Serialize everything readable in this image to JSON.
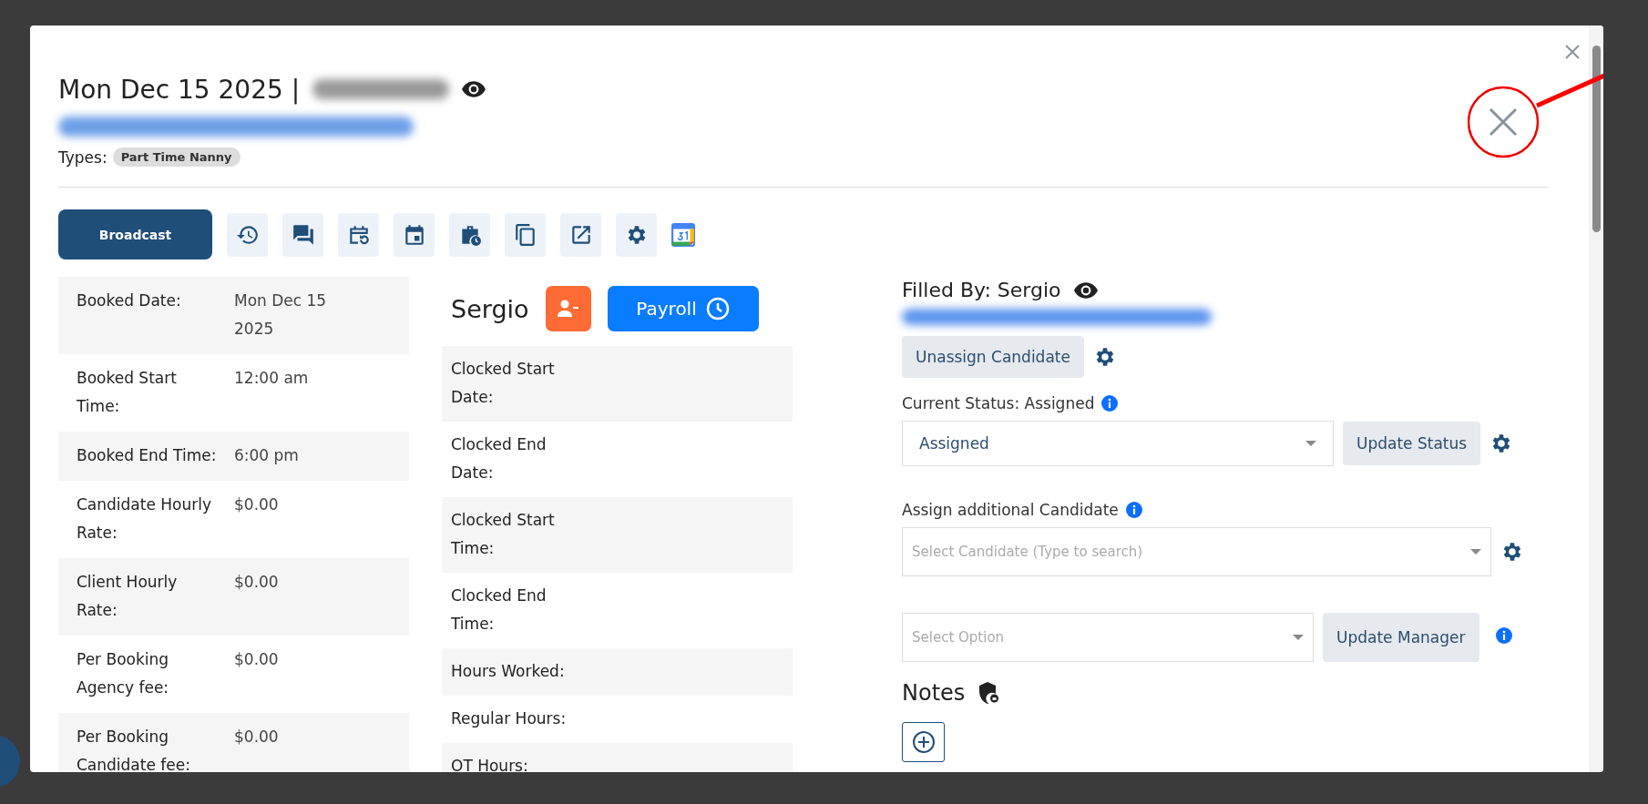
{
  "header": {
    "title": "Mon Dec 15 2025 |",
    "types_label": "Types:",
    "type_tags": [
      "Part Time Nanny"
    ]
  },
  "toolbar": {
    "primary": "Broadcast",
    "tools": [
      {
        "kind": "history"
      },
      {
        "kind": "chat"
      },
      {
        "kind": "reschedule"
      },
      {
        "kind": "event"
      },
      {
        "kind": "briefcase"
      },
      {
        "kind": "copy"
      },
      {
        "kind": "open"
      },
      {
        "kind": "settings"
      },
      {
        "kind": "calendar"
      }
    ]
  },
  "booking_details": [
    {
      "label": "Booked Date:",
      "value": "Mon Dec 15 2025"
    },
    {
      "label": "Booked Start Time:",
      "value": "12:00 am"
    },
    {
      "label": "Booked End Time:",
      "value": "6:00 pm"
    },
    {
      "label": "Candidate Hourly Rate:",
      "value": "$0.00"
    },
    {
      "label": "Client Hourly Rate:",
      "value": "$0.00"
    },
    {
      "label": "Per Booking Agency fee:",
      "value": "$0.00"
    },
    {
      "label": "Per Booking Candidate fee:",
      "value": "$0.00"
    }
  ],
  "candidate": {
    "name": "Sergio",
    "payroll": "Payroll"
  },
  "clock_details": [
    {
      "label": "Clocked Start Date:"
    },
    {
      "label": "Clocked End Date:"
    },
    {
      "label": "Clocked Start Time:"
    },
    {
      "label": "Clocked End Time:"
    },
    {
      "label": "Hours Worked:"
    },
    {
      "label": "Regular Hours:"
    },
    {
      "label": "OT Hours:"
    }
  ],
  "assignment": {
    "filled_by": "Filled By: Sergio",
    "unassign": "Unassign Candidate",
    "status_label": "Current Status: Assigned",
    "status_value": "Assigned",
    "update_status": "Update Status",
    "additional_label": "Assign additional Candidate",
    "candidate_placeholder": "Select Candidate (Type to search)",
    "manager_placeholder": "Select Option",
    "update_manager": "Update Manager"
  },
  "notes": {
    "title": "Notes"
  }
}
